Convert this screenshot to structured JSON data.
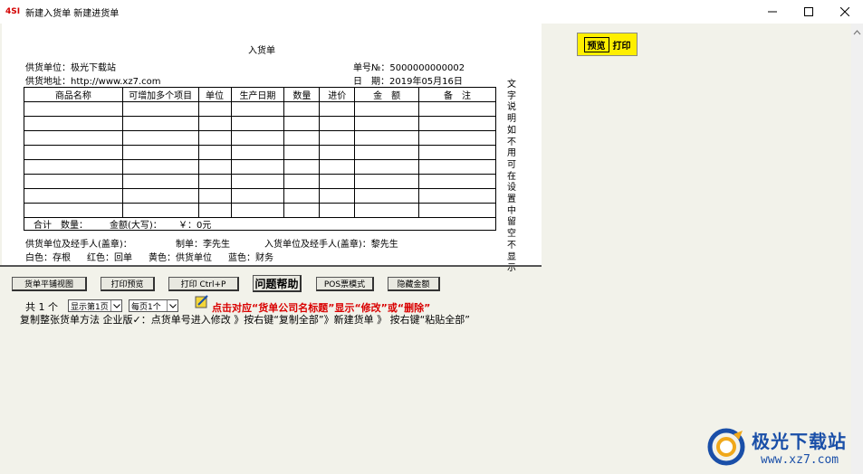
{
  "window": {
    "app_icon": "4SI",
    "title": "新建入货单 新建进货单",
    "minimize_icon": "minimize-icon",
    "maximize_icon": "maximize-icon",
    "close_icon": "close-icon"
  },
  "document": {
    "title": "入货单",
    "supplier_label": "供货单位：极光下载站",
    "address_label": "供货地址：http://www.xz7.com",
    "number_label": "单号№：5000000000002",
    "date_label": "日　期：2019年05月16日",
    "columns": [
      "商品名称",
      "可增加多个项目",
      "单位",
      "生产日期",
      "数量",
      "进价",
      "金　额",
      "备　注"
    ],
    "empty_rows": 8,
    "sum_total": "合计　数量：",
    "sum_amount": "金额(大写)：",
    "sum_value": "￥：0元",
    "vertical_note": "文字说明 如不用可在设置中留空不显示",
    "signer_supplier": "供货单位及经手人(盖章)：",
    "maker": "制单：李先生",
    "signer_receiver": "入货单位及经手人(盖章)：黎先生",
    "copy_white": "白色：存根",
    "copy_red": "红色：回单",
    "copy_yellow": "黄色：供货单位",
    "copy_blue": "蓝色：财务"
  },
  "preview_button": {
    "preview": "预览",
    "print": "打印"
  },
  "toolbar": {
    "flat_view": "货单平铺视图",
    "print_preview": "打印预览",
    "print": "打印 Ctrl+P",
    "help": "问题帮助",
    "pos_mode": "POS票模式",
    "hide_amount": "隐藏金额"
  },
  "pager": {
    "count_text": "共 1 个",
    "page_select": "显示第1页",
    "per_page_select": "每页1个"
  },
  "hint": {
    "red_text": "点击对应“货单公司名标题”显示“修改”或“删除”",
    "copy_help": "复制整张货单方法 企业版✓：点货单号进入修改 》按右键“复制全部”》新建货单 》 按右键“粘贴全部”"
  },
  "watermark": {
    "name": "极光下载站",
    "url": "www.xz7.com"
  }
}
